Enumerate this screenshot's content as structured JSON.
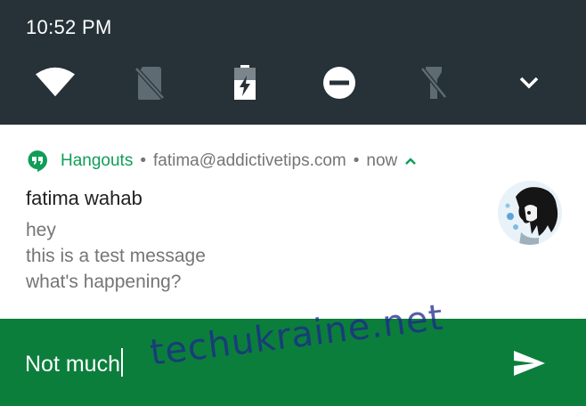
{
  "status": {
    "time": "10:52 PM"
  },
  "quick_settings": {
    "tiles": [
      {
        "name": "wifi-icon"
      },
      {
        "name": "no-sim-icon"
      },
      {
        "name": "battery-saver-icon"
      },
      {
        "name": "do-not-disturb-icon"
      },
      {
        "name": "flashlight-icon"
      },
      {
        "name": "expand-chevron-icon"
      }
    ]
  },
  "notification": {
    "app": "Hangouts",
    "account": "fatima@addictivetips.com",
    "time": "now",
    "separator": "•",
    "sender": "fatima wahab",
    "messages": [
      "hey",
      "this is a test message",
      "what's happening?"
    ],
    "accent_color": "#0f9d58"
  },
  "reply": {
    "value": "Not much",
    "background": "#0b7e3c"
  },
  "watermark": "techukraine.net"
}
